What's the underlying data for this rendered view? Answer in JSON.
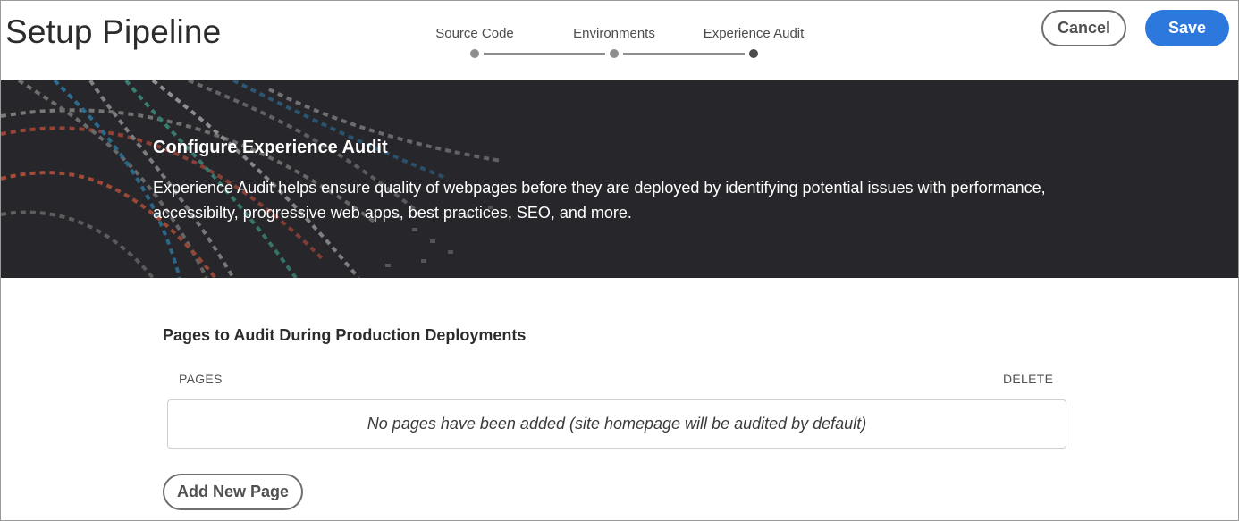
{
  "header": {
    "title": "Setup Pipeline",
    "cancel_label": "Cancel",
    "save_label": "Save"
  },
  "stepper": {
    "steps": [
      {
        "label": "Source Code",
        "state": "done"
      },
      {
        "label": "Environments",
        "state": "done"
      },
      {
        "label": "Experience Audit",
        "state": "current"
      }
    ]
  },
  "hero": {
    "title": "Configure Experience Audit",
    "description": "Experience Audit helps ensure quality of webpages before they are deployed by identifying potential issues with performance, accessibilty, progressive web apps, best practices, SEO, and more."
  },
  "audit_pages": {
    "section_title": "Pages to Audit During Production Deployments",
    "columns": {
      "pages": "PAGES",
      "delete": "DELETE"
    },
    "empty_message": "No pages have been added (site homepage will be audited by default)",
    "add_button_label": "Add New Page"
  },
  "colors": {
    "accent": "#2d78dd",
    "hero_bg": "#26262b",
    "step_active": "#4b4b4b",
    "step_inactive": "#8e8e8e"
  }
}
